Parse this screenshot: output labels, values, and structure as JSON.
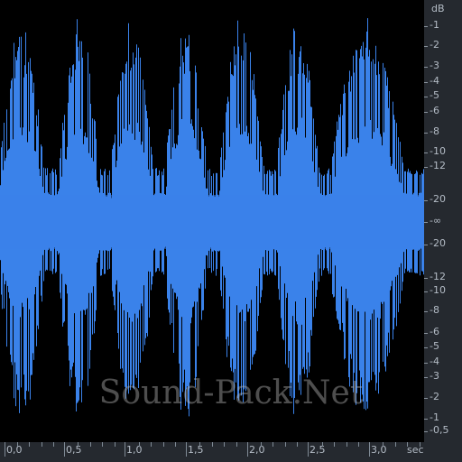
{
  "db_scale": {
    "unit": "dB",
    "labels": [
      "-1",
      "-2",
      "-3",
      "-4",
      "-5",
      "-6",
      "-8",
      "-10",
      "-12",
      "-20",
      "-∞",
      "-20",
      "-12",
      "-10",
      "-8",
      "-6",
      "-5",
      "-4",
      "-3",
      "-2",
      "-1",
      "-0,5"
    ]
  },
  "time_scale": {
    "unit": "sec",
    "labels": [
      "0,0",
      "0,5",
      "1,0",
      "1,5",
      "2,0",
      "2,5",
      "3,0"
    ],
    "values": [
      0.0,
      0.5,
      1.0,
      1.5,
      2.0,
      2.5,
      3.0
    ]
  },
  "watermark": "Sound-Pack.Net",
  "colors": {
    "waveform": "#3a82ea",
    "background": "#000000",
    "panel": "#25292f"
  }
}
